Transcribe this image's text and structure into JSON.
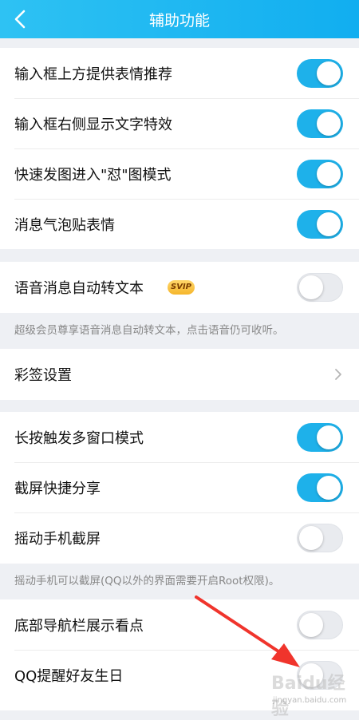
{
  "header": {
    "title": "辅助功能"
  },
  "group1": [
    {
      "label": "输入框上方提供表情推荐",
      "on": true
    },
    {
      "label": "输入框右侧显示文字特效",
      "on": true
    },
    {
      "label": "快速发图进入\"怼\"图模式",
      "on": true
    },
    {
      "label": "消息气泡贴表情",
      "on": true
    }
  ],
  "voice": {
    "label": "语音消息自动转文本",
    "badge": "SVIP",
    "on": false,
    "note": "超级会员尊享语音消息自动转文本，点击语音仍可收听。"
  },
  "caiqian": {
    "label": "彩签设置"
  },
  "group3": [
    {
      "label": "长按触发多窗口模式",
      "on": true
    },
    {
      "label": "截屏快捷分享",
      "on": true
    },
    {
      "label": "摇动手机截屏",
      "on": false
    }
  ],
  "shake_note": "摇动手机可以截屏(QQ以外的界面需要开启Root权限)。",
  "group4": [
    {
      "label": "底部导航栏展示看点",
      "on": false
    },
    {
      "label": "QQ提醒好友生日",
      "on": false
    }
  ],
  "watermark": {
    "text": "Baidu经验",
    "url": "jingyan.baidu.com"
  },
  "colors": {
    "header_start": "#2ec2f3",
    "header_end": "#11aef0",
    "toggle_on": "#1eb1ea",
    "arrow": "#f0342c"
  }
}
